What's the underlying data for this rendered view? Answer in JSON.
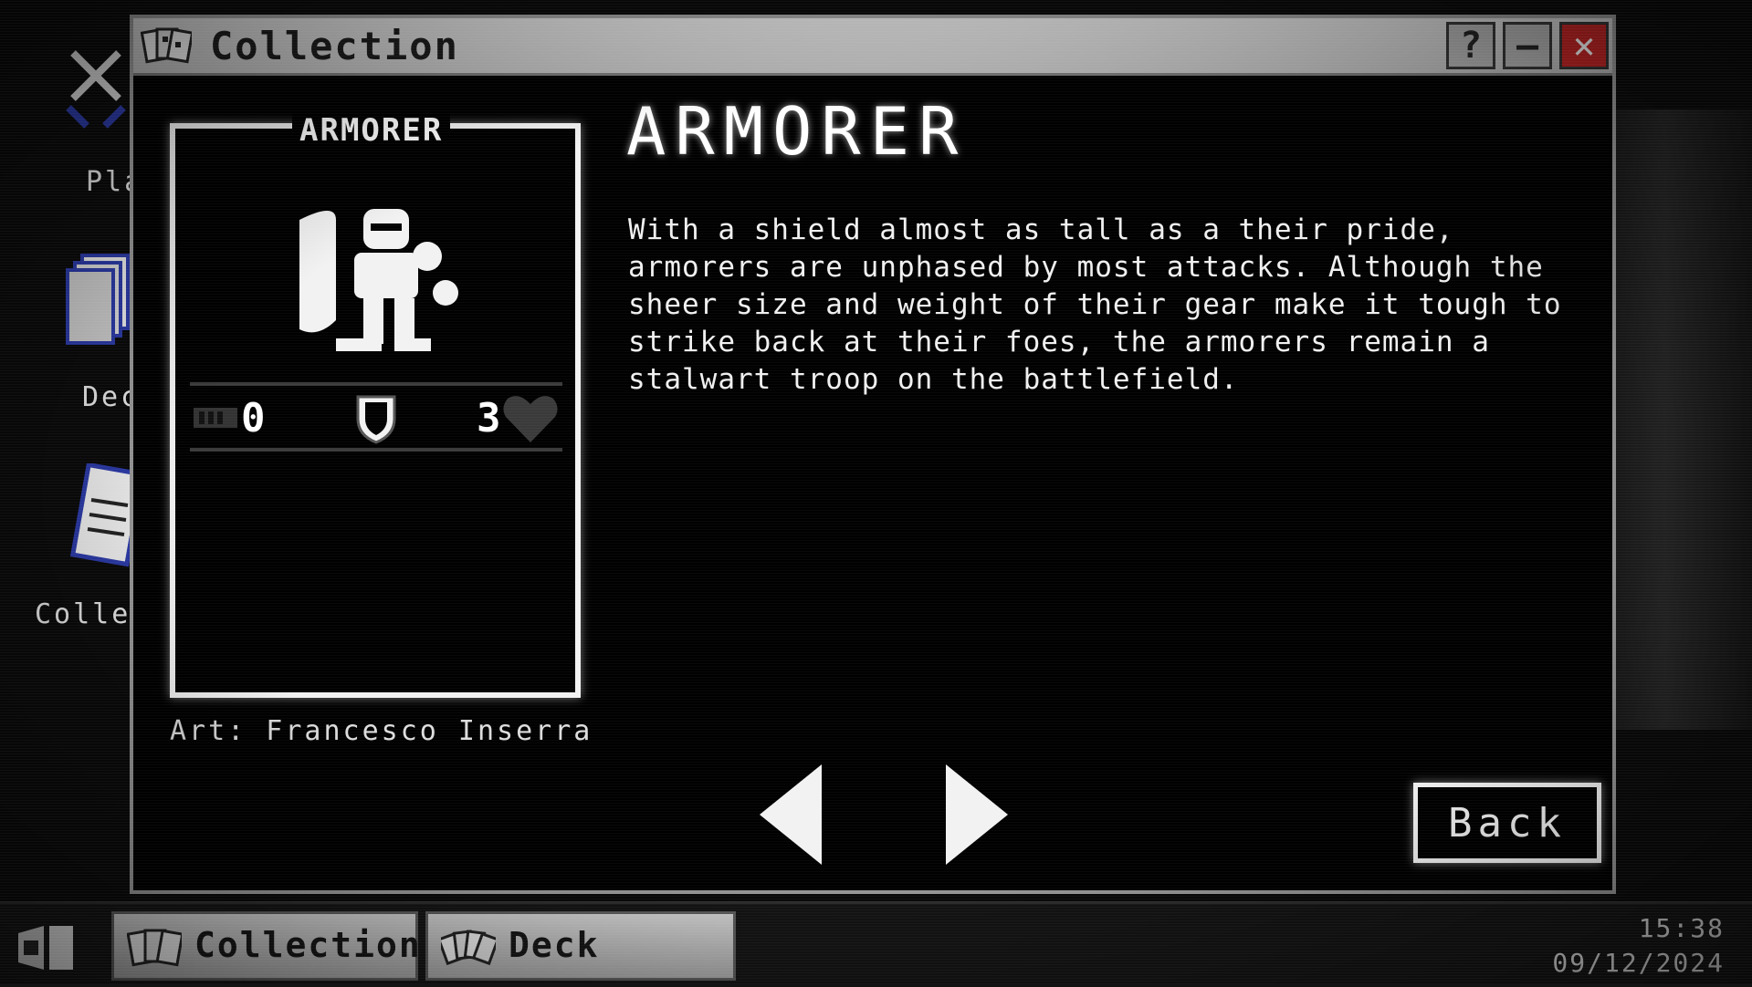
{
  "desktop": {
    "icons": [
      {
        "label": "Play",
        "icon": "swords-icon"
      },
      {
        "label": "Deck",
        "icon": "cards-stack-icon"
      },
      {
        "label": "Collection",
        "icon": "book-icon"
      }
    ]
  },
  "window": {
    "title": "Collection",
    "icon": "cards-icon",
    "buttons": {
      "help": "?",
      "minimize": "—",
      "close": "✕"
    }
  },
  "card": {
    "name": "ARMORER",
    "attack": "0",
    "health": "3",
    "art_credit": "Art: Francesco Inserra"
  },
  "detail": {
    "title": "ARMORER",
    "description": "With a shield almost as tall as a their pride, armorers are unphased by most attacks. Although the sheer size and weight of their gear make it tough to strike back at their foes, the armorers remain a stalwart troop on the battlefield."
  },
  "actions": {
    "back": "Back"
  },
  "taskbar": {
    "items": [
      {
        "label": "Collection",
        "icon": "cards-icon"
      },
      {
        "label": "Deck",
        "icon": "hand-of-cards-icon"
      }
    ],
    "time": "15:38",
    "date": "09/12/2024"
  }
}
